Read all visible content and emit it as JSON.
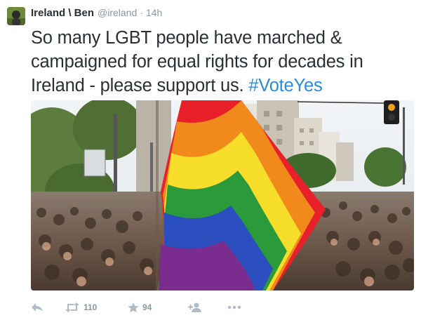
{
  "tweet": {
    "display_name": "Ireland \\ Ben",
    "handle": "@ireland",
    "separator": "·",
    "timestamp": "14h",
    "text_line_1": "So many LGBT people have marched &",
    "text_line_2": "campaigned for equal rights for decades  in",
    "text_line_3": "Ireland - please support us.",
    "hashtag": "#VoteYes"
  },
  "photo": {
    "description_icons": [
      "rainbow-flag",
      "crowd",
      "buildings",
      "traffic-light"
    ],
    "flag_colors": [
      "#e8202a",
      "#f28a1b",
      "#f6de2a",
      "#2a9a3a",
      "#2b4fbf",
      "#7b2c8f"
    ]
  },
  "actions": {
    "reply_icon": "reply-icon",
    "retweet_icon": "retweet-icon",
    "retweet_count": "110",
    "favorite_icon": "star-icon",
    "favorite_count": "94",
    "follow_icon": "follow-icon",
    "more_icon": "more-icon"
  },
  "colors": {
    "text": "#292f33",
    "muted": "#8899a6",
    "icon": "#b1bbc3",
    "link": "#2a8cd8"
  }
}
